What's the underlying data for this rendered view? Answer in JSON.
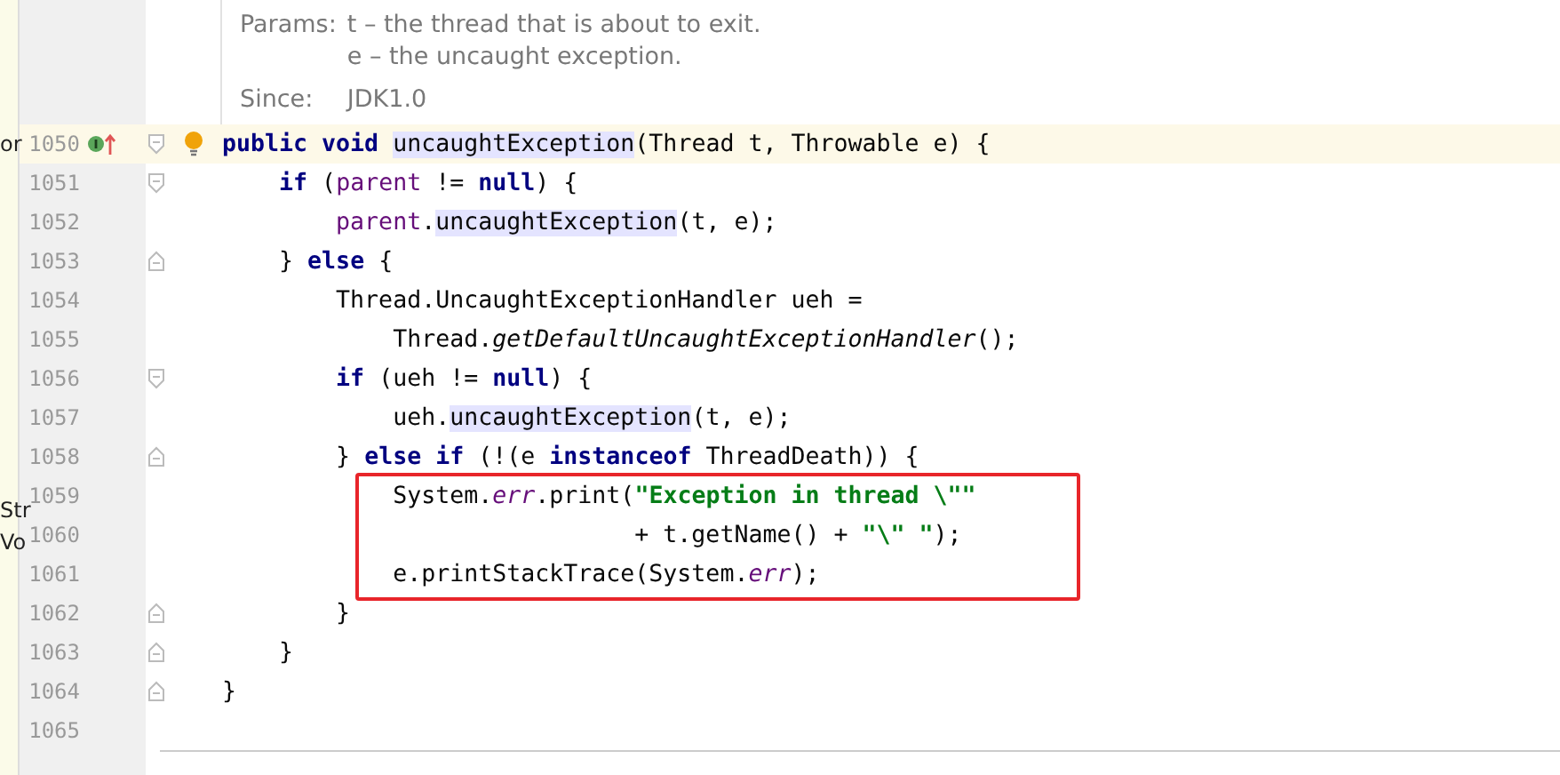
{
  "side_fragments": [
    {
      "text": "or"
    },
    {
      "text": "Str"
    },
    {
      "text": "Vo"
    }
  ],
  "doc_popup": {
    "params_label": "Params:",
    "params": [
      "t – the thread that is about to exit.",
      "e – the uncaught exception."
    ],
    "since_label": "Since:",
    "since": "JDK1.0"
  },
  "lines": [
    {
      "number": "1050",
      "current": true,
      "override_marker": true,
      "bulb": true,
      "fold_start": true,
      "fold_end": false,
      "tokens": [
        {
          "kind": "kw",
          "text": "public void "
        },
        {
          "kind": "usage",
          "text": "uncaughtException"
        },
        {
          "kind": "plain",
          "text": "(Thread t, Throwable e) {"
        }
      ]
    },
    {
      "number": "1051",
      "current": false,
      "override_marker": false,
      "bulb": false,
      "fold_start": true,
      "fold_end": false,
      "tokens": [
        {
          "kind": "kw",
          "text": "    if"
        },
        {
          "kind": "plain",
          "text": " ("
        },
        {
          "kind": "field",
          "text": "parent"
        },
        {
          "kind": "plain",
          "text": " != "
        },
        {
          "kind": "kw",
          "text": "null"
        },
        {
          "kind": "plain",
          "text": ") {"
        }
      ]
    },
    {
      "number": "1052",
      "current": false,
      "override_marker": false,
      "bulb": false,
      "fold_start": false,
      "fold_end": false,
      "tokens": [
        {
          "kind": "field",
          "text": "        parent"
        },
        {
          "kind": "plain",
          "text": "."
        },
        {
          "kind": "usage",
          "text": "uncaughtException"
        },
        {
          "kind": "plain",
          "text": "(t, e);"
        }
      ]
    },
    {
      "number": "1053",
      "current": false,
      "override_marker": false,
      "bulb": false,
      "fold_start": false,
      "fold_end": true,
      "tokens": [
        {
          "kind": "plain",
          "text": "    } "
        },
        {
          "kind": "kw",
          "text": "else"
        },
        {
          "kind": "plain",
          "text": " {"
        }
      ]
    },
    {
      "number": "1054",
      "current": false,
      "override_marker": false,
      "bulb": false,
      "fold_start": false,
      "fold_end": false,
      "tokens": [
        {
          "kind": "plain",
          "text": "        Thread.UncaughtExceptionHandler ueh ="
        }
      ]
    },
    {
      "number": "1055",
      "current": false,
      "override_marker": false,
      "bulb": false,
      "fold_start": false,
      "fold_end": false,
      "tokens": [
        {
          "kind": "plain",
          "text": "            Thread."
        },
        {
          "kind": "static",
          "text": "getDefaultUncaughtExceptionHandler"
        },
        {
          "kind": "plain",
          "text": "();"
        }
      ]
    },
    {
      "number": "1056",
      "current": false,
      "override_marker": false,
      "bulb": false,
      "fold_start": true,
      "fold_end": false,
      "tokens": [
        {
          "kind": "kw",
          "text": "        if"
        },
        {
          "kind": "plain",
          "text": " (ueh != "
        },
        {
          "kind": "kw",
          "text": "null"
        },
        {
          "kind": "plain",
          "text": ") {"
        }
      ]
    },
    {
      "number": "1057",
      "current": false,
      "override_marker": false,
      "bulb": false,
      "fold_start": false,
      "fold_end": false,
      "tokens": [
        {
          "kind": "plain",
          "text": "            ueh."
        },
        {
          "kind": "usage",
          "text": "uncaughtException"
        },
        {
          "kind": "plain",
          "text": "(t, e);"
        }
      ]
    },
    {
      "number": "1058",
      "current": false,
      "override_marker": false,
      "bulb": false,
      "fold_start": false,
      "fold_end": true,
      "tokens": [
        {
          "kind": "plain",
          "text": "        } "
        },
        {
          "kind": "kw",
          "text": "else if"
        },
        {
          "kind": "plain",
          "text": " (!(e "
        },
        {
          "kind": "kw",
          "text": "instanceof"
        },
        {
          "kind": "plain",
          "text": " ThreadDeath)) {"
        }
      ]
    },
    {
      "number": "1059",
      "current": false,
      "override_marker": false,
      "bulb": false,
      "fold_start": false,
      "fold_end": false,
      "tokens": [
        {
          "kind": "plain",
          "text": "            System."
        },
        {
          "kind": "sfield",
          "text": "err"
        },
        {
          "kind": "plain",
          "text": ".print("
        },
        {
          "kind": "string",
          "text": "\"Exception in thread \\\"\""
        }
      ]
    },
    {
      "number": "1060",
      "current": false,
      "override_marker": false,
      "bulb": false,
      "fold_start": false,
      "fold_end": false,
      "tokens": [
        {
          "kind": "plain",
          "text": "                             + t.getName() + "
        },
        {
          "kind": "string",
          "text": "\"\\\" \""
        },
        {
          "kind": "plain",
          "text": ");"
        }
      ]
    },
    {
      "number": "1061",
      "current": false,
      "override_marker": false,
      "bulb": false,
      "fold_start": false,
      "fold_end": false,
      "tokens": [
        {
          "kind": "plain",
          "text": "            e.printStackTrace(System."
        },
        {
          "kind": "sfield",
          "text": "err"
        },
        {
          "kind": "plain",
          "text": ");"
        }
      ]
    },
    {
      "number": "1062",
      "current": false,
      "override_marker": false,
      "bulb": false,
      "fold_start": false,
      "fold_end": true,
      "tokens": [
        {
          "kind": "plain",
          "text": "        }"
        }
      ]
    },
    {
      "number": "1063",
      "current": false,
      "override_marker": false,
      "bulb": false,
      "fold_start": false,
      "fold_end": true,
      "tokens": [
        {
          "kind": "plain",
          "text": "    }"
        }
      ]
    },
    {
      "number": "1064",
      "current": false,
      "override_marker": false,
      "bulb": false,
      "fold_start": false,
      "fold_end": true,
      "tokens": [
        {
          "kind": "plain",
          "text": "}"
        }
      ]
    },
    {
      "number": "1065",
      "current": false,
      "override_marker": false,
      "bulb": false,
      "fold_start": false,
      "fold_end": false
    }
  ]
}
